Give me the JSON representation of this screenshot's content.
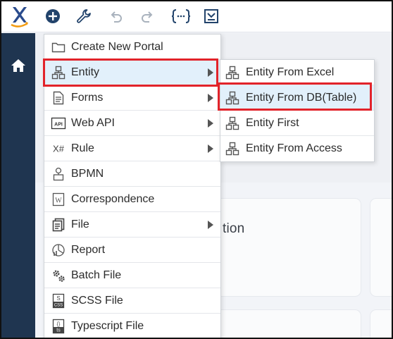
{
  "colors": {
    "sidebar": "#1f3550",
    "highlight_border": "#e2232a",
    "active_row": "#e2f0fb",
    "brand_x": "#2a4b8d",
    "brand_swoosh": "#f39c12"
  },
  "toolbar": {
    "logo_icon": "x-logo-icon",
    "buttons": [
      {
        "name": "add-circle-icon"
      },
      {
        "name": "wrench-icon"
      },
      {
        "name": "undo-icon"
      },
      {
        "name": "redo-icon"
      },
      {
        "name": "curly-braces-icon"
      },
      {
        "name": "document-export-icon"
      }
    ]
  },
  "sidebar": {
    "home_icon": "home-icon"
  },
  "background": {
    "card_text": "tion"
  },
  "menu": {
    "items": [
      {
        "label": "Create New Portal",
        "icon": "folder-icon",
        "submenu": false
      },
      {
        "label": "Entity",
        "icon": "hierarchy-icon",
        "submenu": true
      },
      {
        "label": "Forms",
        "icon": "form-doc-icon",
        "submenu": true
      },
      {
        "label": "Web API",
        "icon": "api-icon",
        "submenu": true
      },
      {
        "label": "Rule",
        "icon": "x-sharp-icon",
        "submenu": true
      },
      {
        "label": "BPMN",
        "icon": "bpmn-icon",
        "submenu": false
      },
      {
        "label": "Correspondence",
        "icon": "correspondence-icon",
        "submenu": false
      },
      {
        "label": "File",
        "icon": "file-icon",
        "submenu": true
      },
      {
        "label": "Report",
        "icon": "report-icon",
        "submenu": false
      },
      {
        "label": "Batch File",
        "icon": "gears-icon",
        "submenu": false
      },
      {
        "label": "SCSS File",
        "icon": "scss-file-icon",
        "submenu": false
      },
      {
        "label": "Typescript File",
        "icon": "ts-file-icon",
        "submenu": false
      }
    ],
    "api_icon_text": "API",
    "rule_icon_text": "X#",
    "correspondence_icon_text": "W",
    "scss_icon_top": "S",
    "scss_icon_bottom": "CSS",
    "ts_icon_top": "{}",
    "ts_icon_bottom": "ts"
  },
  "submenu": {
    "items": [
      {
        "label": "Entity From Excel"
      },
      {
        "label": "Entity From DB(Table)"
      },
      {
        "label": "Entity First"
      },
      {
        "label": "Entity From Access"
      }
    ]
  }
}
